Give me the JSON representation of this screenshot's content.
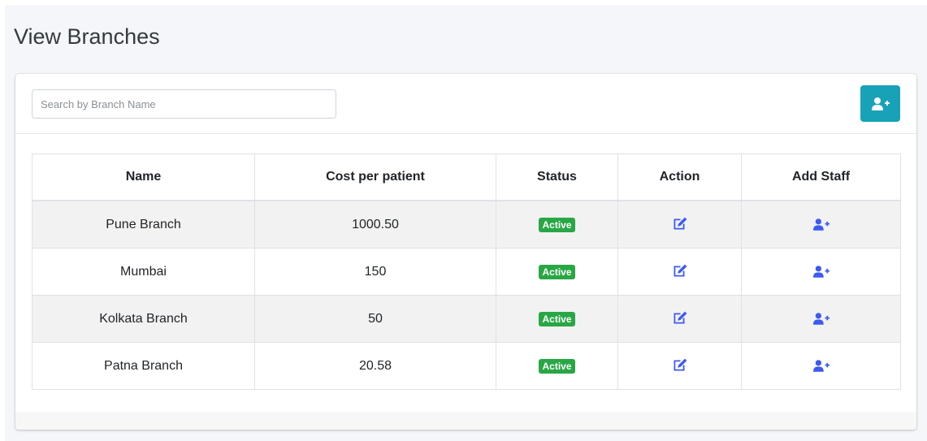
{
  "page": {
    "title": "View Branches"
  },
  "search": {
    "placeholder": "Search by Branch Name",
    "value": ""
  },
  "toolbar": {
    "add_icon": "user-plus-icon"
  },
  "colors": {
    "accent": "#17a2b8",
    "status_active": "#28a745",
    "action_icon": "#3d5af1"
  },
  "table": {
    "columns": [
      "Name",
      "Cost per patient",
      "Status",
      "Action",
      "Add Staff"
    ],
    "rows": [
      {
        "name": "Pune Branch",
        "cost": "1000.50",
        "status": "Active",
        "action_icon": "edit-icon",
        "staff_icon": "user-plus-icon"
      },
      {
        "name": "Mumbai",
        "cost": "150",
        "status": "Active",
        "action_icon": "edit-icon",
        "staff_icon": "user-plus-icon"
      },
      {
        "name": "Kolkata Branch",
        "cost": "50",
        "status": "Active",
        "action_icon": "edit-icon",
        "staff_icon": "user-plus-icon"
      },
      {
        "name": "Patna Branch",
        "cost": "20.58",
        "status": "Active",
        "action_icon": "edit-icon",
        "staff_icon": "user-plus-icon"
      }
    ]
  }
}
